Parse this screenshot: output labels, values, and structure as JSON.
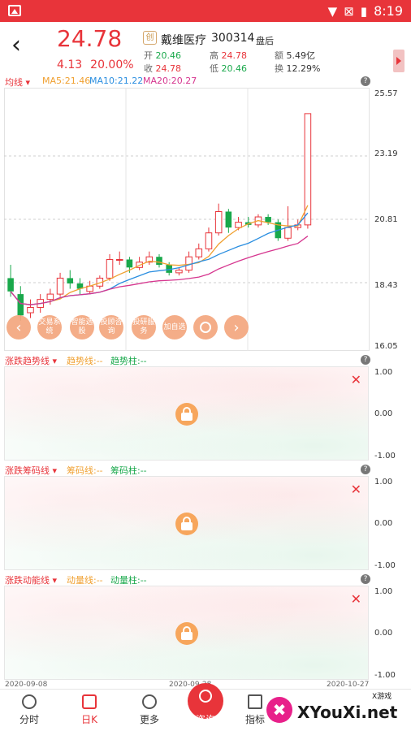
{
  "status_bar": {
    "time": "8:19"
  },
  "header": {
    "price": "24.78",
    "change_amount": "4.13",
    "change_percent": "20.00%",
    "badge": "创",
    "stock_name": "戴维医疗",
    "stock_code": "300314",
    "market_status": "盘后",
    "quote": {
      "open_label": "开",
      "open_value": "20.46",
      "high_label": "高",
      "high_value": "24.78",
      "amount_label": "额",
      "amount_value": "5.49亿",
      "close_label": "收",
      "close_value": "24.78",
      "low_label": "低",
      "low_value": "20.46",
      "turnover_label": "换",
      "turnover_value": "12.29%"
    }
  },
  "main_chart": {
    "indicator_label": "均线",
    "ma5": "MA5:21.46",
    "ma10": "MA10:21.22",
    "ma20": "MA20:20.27",
    "y_labels": [
      "25.57",
      "23.19",
      "20.81",
      "18.43",
      "16.05"
    ],
    "quick_actions": [
      "交易系统",
      "智能选股",
      "投顾咨询",
      "投研服务",
      "加自选"
    ],
    "colors": {
      "up": "#e8343a",
      "down": "#19a84b",
      "ma5": "#f0a030",
      "ma10": "#2a8ee0",
      "ma20": "#d6368f"
    }
  },
  "chart_data": {
    "type": "candlestick",
    "ylim": [
      16.05,
      25.57
    ],
    "candles": [
      [
        18.6,
        18.1,
        19.1,
        17.9
      ],
      [
        18.0,
        17.2,
        18.3,
        17.0
      ],
      [
        17.3,
        17.5,
        17.8,
        17.1
      ],
      [
        17.5,
        17.8,
        18.0,
        17.3
      ],
      [
        17.8,
        18.0,
        18.2,
        17.6
      ],
      [
        18.0,
        18.6,
        18.8,
        17.9
      ],
      [
        18.6,
        18.4,
        18.9,
        18.2
      ],
      [
        18.4,
        18.2,
        18.6,
        18.0
      ],
      [
        18.1,
        18.3,
        18.5,
        18.0
      ],
      [
        18.3,
        18.6,
        18.7,
        18.2
      ],
      [
        18.6,
        19.3,
        19.5,
        18.5
      ],
      [
        19.3,
        19.3,
        19.6,
        19.1
      ],
      [
        19.3,
        19.0,
        19.4,
        18.8
      ],
      [
        19.0,
        19.2,
        19.4,
        18.9
      ],
      [
        19.2,
        19.4,
        19.6,
        19.1
      ],
      [
        19.4,
        19.1,
        19.5,
        19.0
      ],
      [
        19.1,
        18.8,
        19.2,
        18.7
      ],
      [
        18.8,
        18.9,
        19.0,
        18.7
      ],
      [
        18.9,
        19.4,
        19.6,
        18.8
      ],
      [
        19.4,
        19.7,
        19.9,
        19.3
      ],
      [
        19.7,
        20.3,
        20.5,
        19.6
      ],
      [
        20.3,
        21.1,
        21.4,
        20.2
      ],
      [
        21.1,
        20.5,
        21.2,
        20.3
      ],
      [
        20.5,
        20.7,
        20.9,
        20.4
      ],
      [
        20.7,
        20.6,
        20.9,
        20.5
      ],
      [
        20.6,
        20.9,
        21.0,
        20.5
      ],
      [
        20.9,
        20.7,
        21.0,
        20.6
      ],
      [
        20.7,
        20.1,
        20.8,
        20.0
      ],
      [
        20.1,
        20.5,
        21.3,
        20.0
      ],
      [
        20.5,
        20.6,
        20.8,
        20.4
      ],
      [
        20.6,
        24.78,
        24.78,
        20.46
      ]
    ],
    "x_labels": [
      "2020-09-08",
      "2020-09-28",
      "2020-10-27"
    ]
  },
  "panels": [
    {
      "title": "涨跌趋势线",
      "line1": "趋势线:--",
      "line2": "趋势柱:--",
      "y_labels": [
        "1.00",
        "0.00",
        "-1.00"
      ]
    },
    {
      "title": "涨跌筹码线",
      "line1": "筹码线:--",
      "line2": "筹码柱:--",
      "y_labels": [
        "1.00",
        "0.00",
        "-1.00"
      ]
    },
    {
      "title": "涨跌动能线",
      "line1": "动量线:--",
      "line2": "动量柱:--",
      "y_labels": [
        "1.00",
        "0.00",
        "-1.00"
      ]
    }
  ],
  "tabs": [
    "分时",
    "日K",
    "更多",
    "咨询",
    "指标"
  ],
  "watermark": {
    "text": "XYouXi.net",
    "small": "X游戏"
  }
}
